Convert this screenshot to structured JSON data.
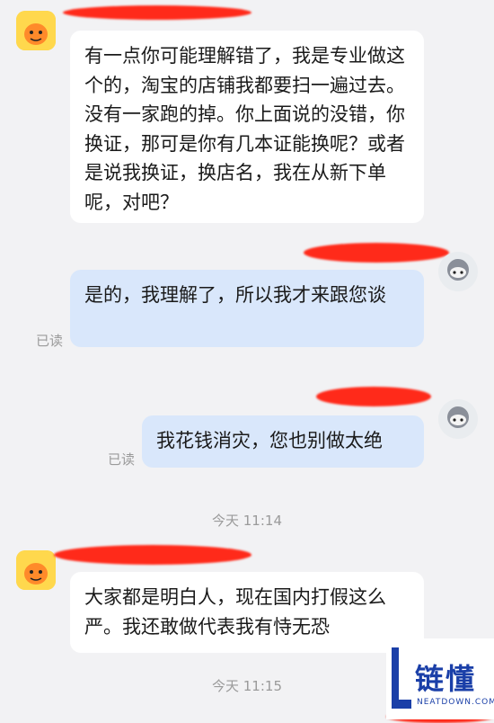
{
  "messages": [
    {
      "side": "left",
      "text": "有一点你可能理解错了，我是专业做这个的，淘宝的店铺我都要扫一遍过去。没有一家跑的掉。你上面说的没错，你换证，那可是你有几本证能换呢？或者是说我换证，换店名，我在从新下单呢，对吧？"
    },
    {
      "side": "right",
      "text": "是的，我理解了，所以我才来跟您谈",
      "status": "已读"
    },
    {
      "side": "right",
      "text": "我花钱消灾，您也别做太绝",
      "status": "已读"
    },
    {
      "side": "left",
      "text": "大家都是明白人，现在国内打假这么严。我还敢做代表我有恃无恐"
    }
  ],
  "timestamps": [
    "今天 11:14",
    "今天 11:15"
  ],
  "watermark": {
    "brand": "链懂",
    "site": "NEATDOWN.COM"
  },
  "colors": {
    "redaction": "#ff2a1a",
    "bubble_right": "#d9e7fb",
    "bubble_left": "#ffffff"
  }
}
